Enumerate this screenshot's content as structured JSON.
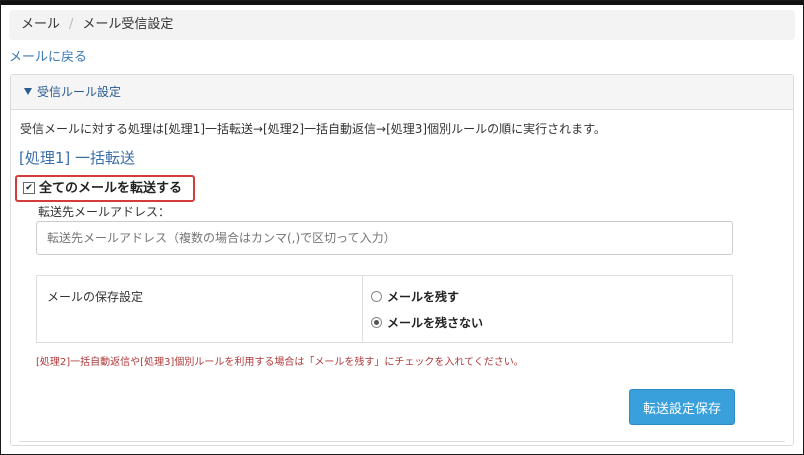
{
  "breadcrumb": {
    "items": [
      "メール",
      "メール受信設定"
    ],
    "separator": "/"
  },
  "back_link": "メールに戻る",
  "panel": {
    "title": "受信ルール設定",
    "description": "受信メールに対する処理は[処理1]一括転送→[処理2]一括自動返信→[処理3]個別ルールの順に実行されます。",
    "section_title": "[処理1] 一括転送",
    "forward_all": {
      "label": "全てのメールを転送する",
      "checked": true
    },
    "address": {
      "label": "転送先メールアドレス：",
      "placeholder": "転送先メールアドレス（複数の場合はカンマ(,)で区切って入力）",
      "value": ""
    },
    "mail_save": {
      "label": "メールの保存設定",
      "options": [
        {
          "label": "メールを残す",
          "selected": false
        },
        {
          "label": "メールを残さない",
          "selected": true
        }
      ]
    },
    "note": "[処理2]一括自動返信や[処理3]個別ルールを利用する場合は「メールを残す」にチェックを入れてください。",
    "save_button": "転送設定保存"
  },
  "colors": {
    "accent": "#3aa0dc",
    "link": "#3a7ab8",
    "highlight_border": "#d43b3b",
    "note": "#b03a3a"
  }
}
